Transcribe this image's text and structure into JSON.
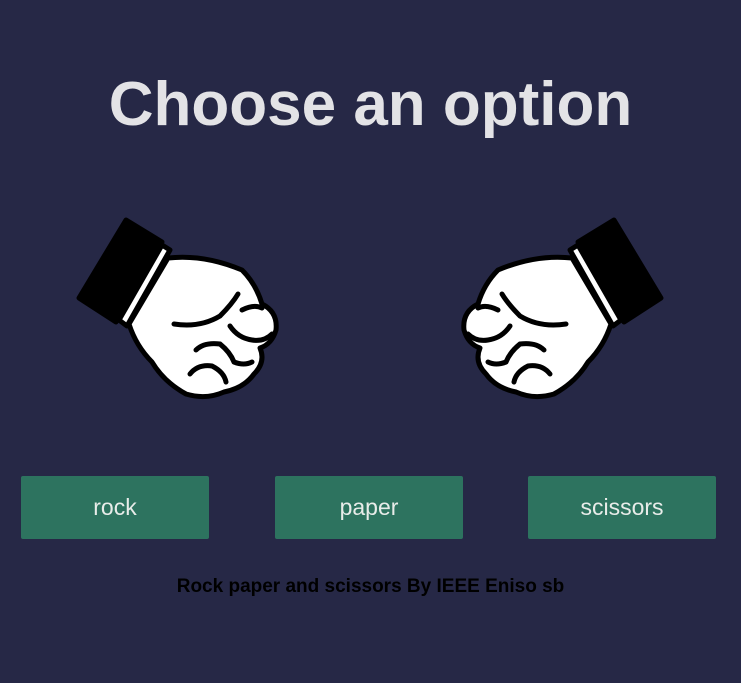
{
  "title": "Choose an option",
  "hands": {
    "left_icon": "fist-icon",
    "right_icon": "fist-icon"
  },
  "buttons": {
    "rock": "rock",
    "paper": "paper",
    "scissors": "scissors"
  },
  "footer": "Rock paper and scissors By IEEE Eniso sb",
  "colors": {
    "background": "#262846",
    "title": "#e3e3e6",
    "button": "#2d735f",
    "button_text": "#e8ece9",
    "footer_text": "#000000"
  }
}
